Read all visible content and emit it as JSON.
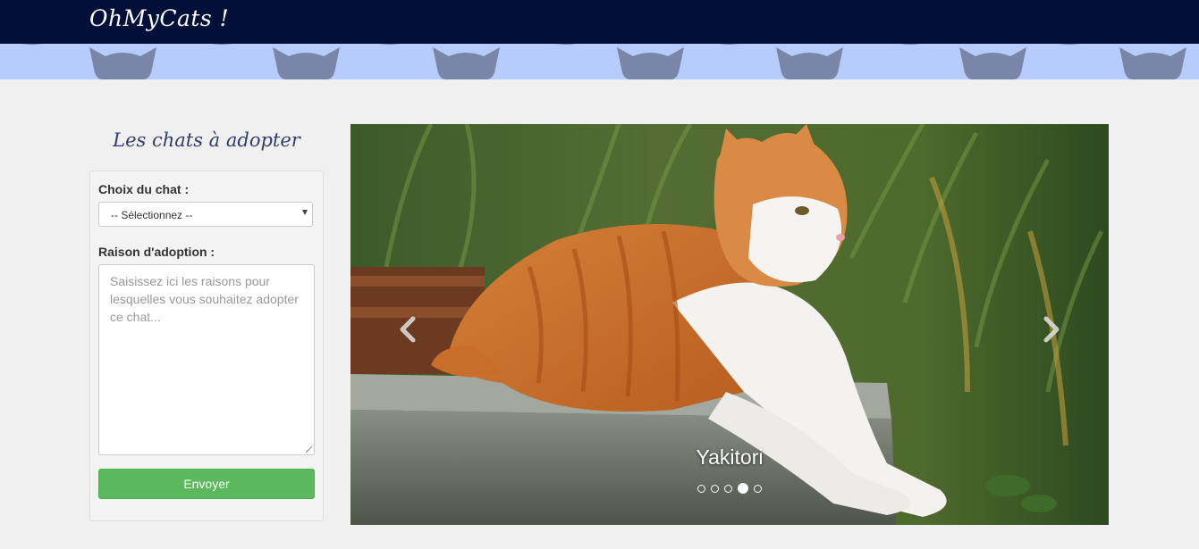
{
  "navbar": {
    "brand": "OhMyCats !"
  },
  "colors": {
    "navbar_bg": "#020f39",
    "banner_bg": "#b8ccfb",
    "cat_silhouette": "#7a86a8",
    "button_green": "#5cb85c"
  },
  "sidebar": {
    "title": "Les chats à adopter",
    "form": {
      "cat_choice_label": "Choix du chat :",
      "cat_select_value": "-- Sélectionnez --",
      "reason_label": "Raison d'adoption :",
      "reason_placeholder": "Saisissez ici les raisons pour lesquelles vous souhaitez adopter ce chat...",
      "submit_label": "Envoyer"
    }
  },
  "carousel": {
    "caption": "Yakitori",
    "slide_count": 5,
    "active_index": 4,
    "icons": {
      "prev": "chevron-left-icon",
      "next": "chevron-right-icon"
    }
  }
}
